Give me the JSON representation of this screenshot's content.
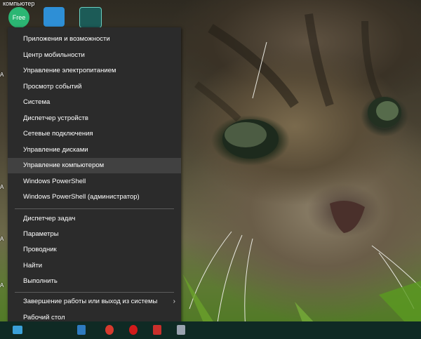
{
  "desktop": {
    "top_label": "компьютер",
    "side_letters": [
      "А",
      "А",
      "А",
      "А"
    ]
  },
  "menu": {
    "items_group1": [
      "Приложения и возможности",
      "Центр мобильности",
      "Управление электропитанием",
      "Просмотр событий",
      "Система",
      "Диспетчер устройств",
      "Сетевые подключения",
      "Управление дисками",
      "Управление компьютером",
      "Windows PowerShell",
      "Windows PowerShell (администратор)"
    ],
    "items_group2": [
      "Диспетчер задач",
      "Параметры",
      "Проводник",
      "Найти",
      "Выполнить"
    ],
    "items_group3": [
      "Завершение работы или выход из системы",
      "Рабочий стол"
    ],
    "highlighted": "Управление компьютером",
    "submenu_arrow": "›"
  },
  "colors": {
    "menu_bg": "#2b2b2b",
    "highlight": "#414141",
    "taskbar": "#0f2a24"
  }
}
